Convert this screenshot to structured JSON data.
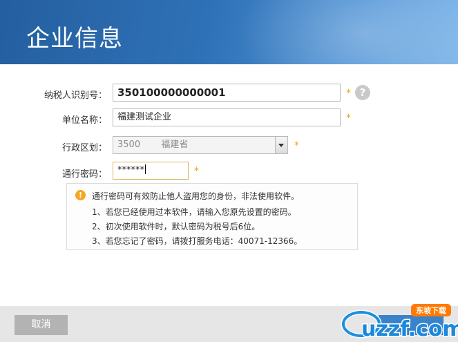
{
  "header": {
    "title": "企业信息"
  },
  "form": {
    "tax_id": {
      "label": "纳税人识别号：",
      "value": "350100000000001"
    },
    "company_name": {
      "label": "单位名称：",
      "value": "福建测试企业"
    },
    "region": {
      "label": "行政区划：",
      "code": "3500",
      "name": "福建省"
    },
    "password": {
      "label": "通行密码：",
      "value": "******"
    },
    "required_mark": "*",
    "help_glyph": "?"
  },
  "notice": {
    "icon_glyph": "!",
    "headline": "通行密码可有效防止他人盗用您的身份，非法使用软件。",
    "items": [
      "1、若您已经使用过本软件，请输入您原先设置的密码。",
      "2、初次使用软件时，默认密码为税号后6位。",
      "3、若您忘记了密码，请拨打服务电话：40071-12366。"
    ]
  },
  "footer": {
    "cancel_label": "取消",
    "watermark_text": "uzzf.com",
    "watermark_badge": "东坡下载"
  },
  "colors": {
    "header_blue": "#2f71b6",
    "accent_orange": "#f0a21a",
    "confirm_blue": "#3a82c9"
  }
}
